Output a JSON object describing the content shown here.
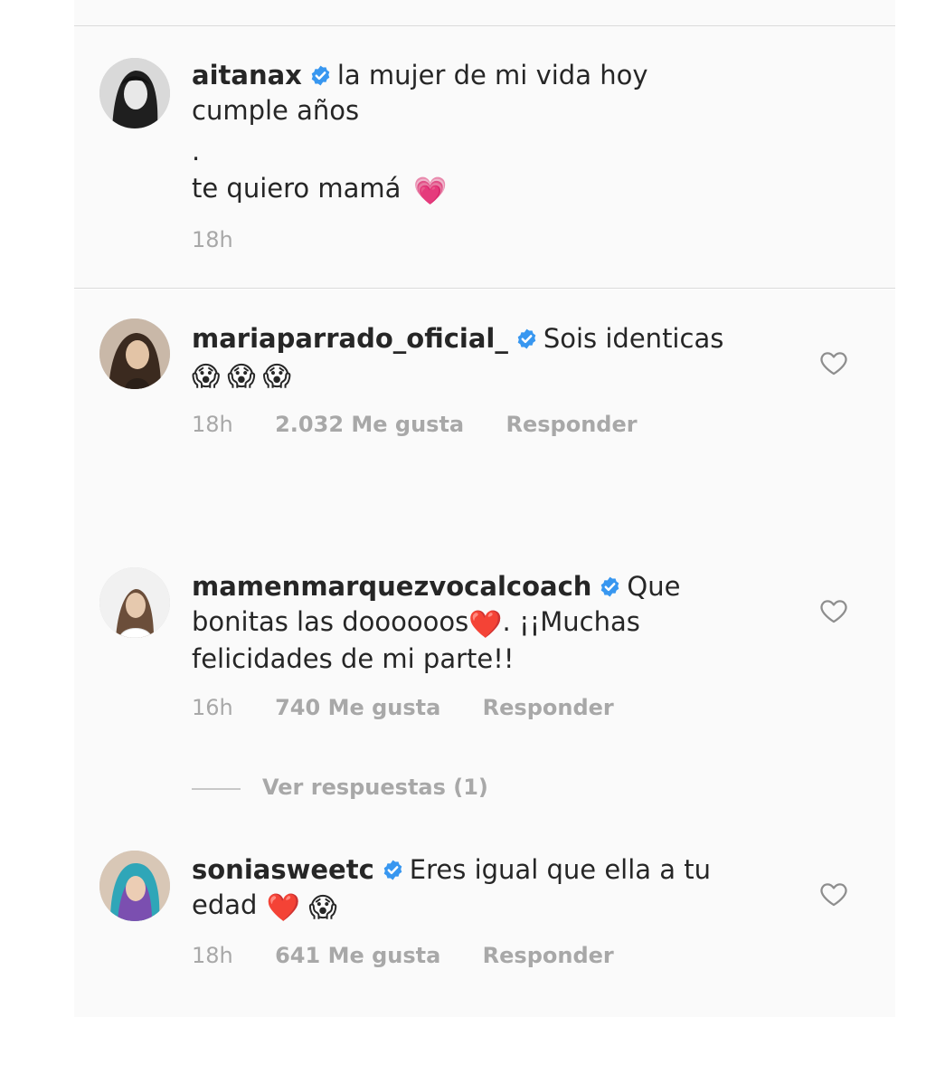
{
  "caption": {
    "username": "aitanax",
    "text_line1": "la mujer de mi vida hoy",
    "text_line2": "cumple años",
    "text_line3": ".",
    "text_line4": "te quiero mamá",
    "emoji": "💗",
    "time": "18h"
  },
  "comments": [
    {
      "username": "mariaparrado_oficial_",
      "text_line1": "Sois identicas",
      "emojis": "😱😱😱",
      "time": "18h",
      "likes": "2.032 Me gusta",
      "reply": "Responder",
      "avatar_icon": "avatar-photo-icon"
    },
    {
      "username": "mamenmarquezvocalcoach",
      "text_line1": "Que",
      "text_line2_a": "bonitas las doooooos",
      "text_line2_emoji": "❤️",
      "text_line2_b": ". ¡¡Muchas",
      "text_line3": "felicidades de mi parte!!",
      "time": "16h",
      "likes": "740 Me gusta",
      "reply": "Responder",
      "view_replies": "Ver respuestas (1)"
    },
    {
      "username": "soniasweetc",
      "text_line1": "Eres igual que ella a tu",
      "text_line2": "edad",
      "emojis": "❤️ 😱",
      "time": "18h",
      "likes": "641 Me gusta",
      "reply": "Responder"
    }
  ],
  "colors": {
    "verified_blue": "#3897f0",
    "meta_gray": "#a8a8a8",
    "panel_bg": "#fafafa",
    "divider": "#dbdbdb"
  },
  "icons": {
    "verified": "verified-badge-icon",
    "like": "heart-outline-icon"
  }
}
